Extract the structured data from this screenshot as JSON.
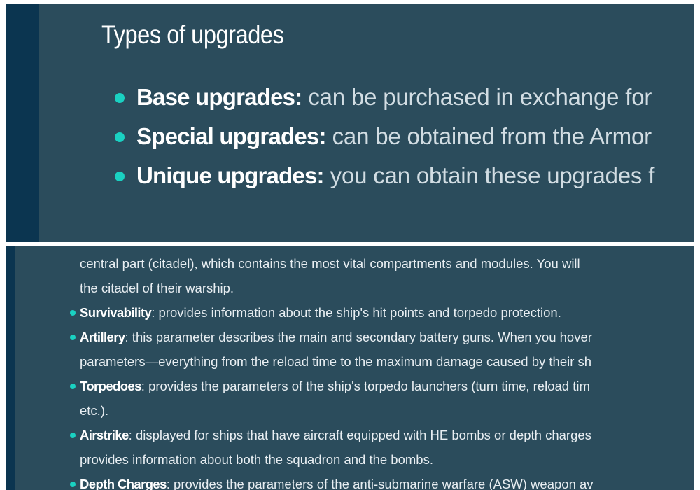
{
  "upgrades_section": {
    "title": "Types of upgrades",
    "items": [
      {
        "term": "Base upgrades:",
        "text": " can be purchased in exchange for"
      },
      {
        "term": "Special upgrades:",
        "text": " can be obtained from the Armor"
      },
      {
        "term": "Unique upgrades:",
        "text": " you can obtain these upgrades f"
      }
    ]
  },
  "parameters_section": {
    "intro_lines": [
      "central part (citadel), which contains the most vital compartments and modules. You will",
      "the citadel of their warship."
    ],
    "items": [
      {
        "term": "Survivability",
        "text": ": provides information about the ship's hit points and torpedo protection."
      },
      {
        "term": "Artillery",
        "text": ": this parameter describes the main and secondary battery guns. When you hover",
        "continuation": "parameters—everything from the reload time to the maximum damage caused by their sh"
      },
      {
        "term": "Torpedoes",
        "text": ": provides the parameters of the ship's torpedo launchers (turn time, reload tim",
        "continuation": "etc.)."
      },
      {
        "term": "Airstrike",
        "text": ": displayed for ships that have aircraft equipped with HE bombs or depth charges",
        "continuation": "provides information about both the squadron and the bombs."
      },
      {
        "term": "Depth Charges",
        "text": ": provides the parameters of the anti-submarine warfare (ASW) weapon av"
      }
    ]
  },
  "colors": {
    "panel": "#2b4c5c",
    "sidebar": "#0b3550",
    "bullet": "#1ad1c2"
  }
}
